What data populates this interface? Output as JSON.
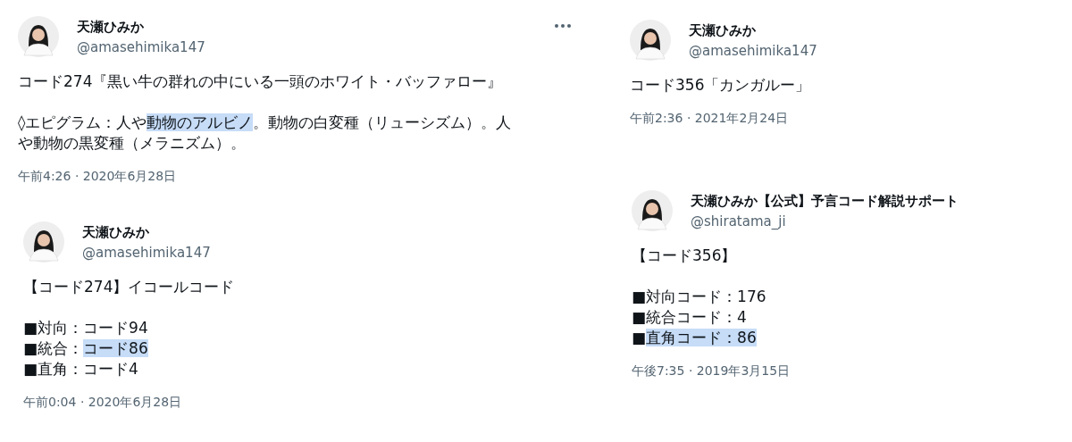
{
  "columns": [
    {
      "tweets": [
        {
          "name": "天瀬ひみか",
          "handle": "@amasehimika147",
          "more": true,
          "body": [
            [
              [
                {
                  "text": "コード274『黒い牛の群れの中にいる一頭のホワイト・バッファロー』",
                  "highlighted": false
                }
              ]
            ],
            [
              [
                {
                  "text": "◊エピグラム：人や",
                  "highlighted": false
                },
                {
                  "text": "動物のアルビノ",
                  "highlighted": true
                },
                {
                  "text": "。動物の白変種（リューシズム）。人",
                  "highlighted": false
                }
              ],
              [
                {
                  "text": "や動物の黒変種（メラニズム）。",
                  "highlighted": false
                }
              ]
            ]
          ],
          "time": "午前4:26 · 2020年6月28日"
        },
        {
          "name": "天瀬ひみか",
          "handle": "@amasehimika147",
          "more": false,
          "body": [
            [
              [
                {
                  "text": "【コード274】イコールコード",
                  "highlighted": false
                }
              ]
            ],
            [
              [
                {
                  "text": "■対向：コード94",
                  "highlighted": false
                }
              ],
              [
                {
                  "text": "■統合：",
                  "highlighted": false
                },
                {
                  "text": "コード86",
                  "highlighted": true
                }
              ],
              [
                {
                  "text": "■直角：コード4",
                  "highlighted": false
                }
              ]
            ]
          ],
          "time": "午前0:04 · 2020年6月28日"
        }
      ]
    },
    {
      "tweets": [
        {
          "name": "天瀬ひみか",
          "handle": "@amasehimika147",
          "more": false,
          "body": [
            [
              [
                {
                  "text": "コード356「カンガルー」",
                  "highlighted": false
                }
              ]
            ]
          ],
          "time": "午前2:36 · 2021年2月24日"
        },
        {
          "name": "天瀬ひみか【公式】予言コード解説サポート",
          "handle": "@shiratama_ji",
          "more": false,
          "body": [
            [
              [
                {
                  "text": "【コード356】",
                  "highlighted": false
                }
              ]
            ],
            [
              [
                {
                  "text": "■対向コード：176",
                  "highlighted": false
                }
              ],
              [
                {
                  "text": "■統合コード：4",
                  "highlighted": false
                }
              ],
              [
                {
                  "text": "■",
                  "highlighted": false
                },
                {
                  "text": "直角コード：86",
                  "highlighted": true
                }
              ]
            ]
          ],
          "time": "午後7:35 · 2019年3月15日"
        }
      ]
    }
  ]
}
